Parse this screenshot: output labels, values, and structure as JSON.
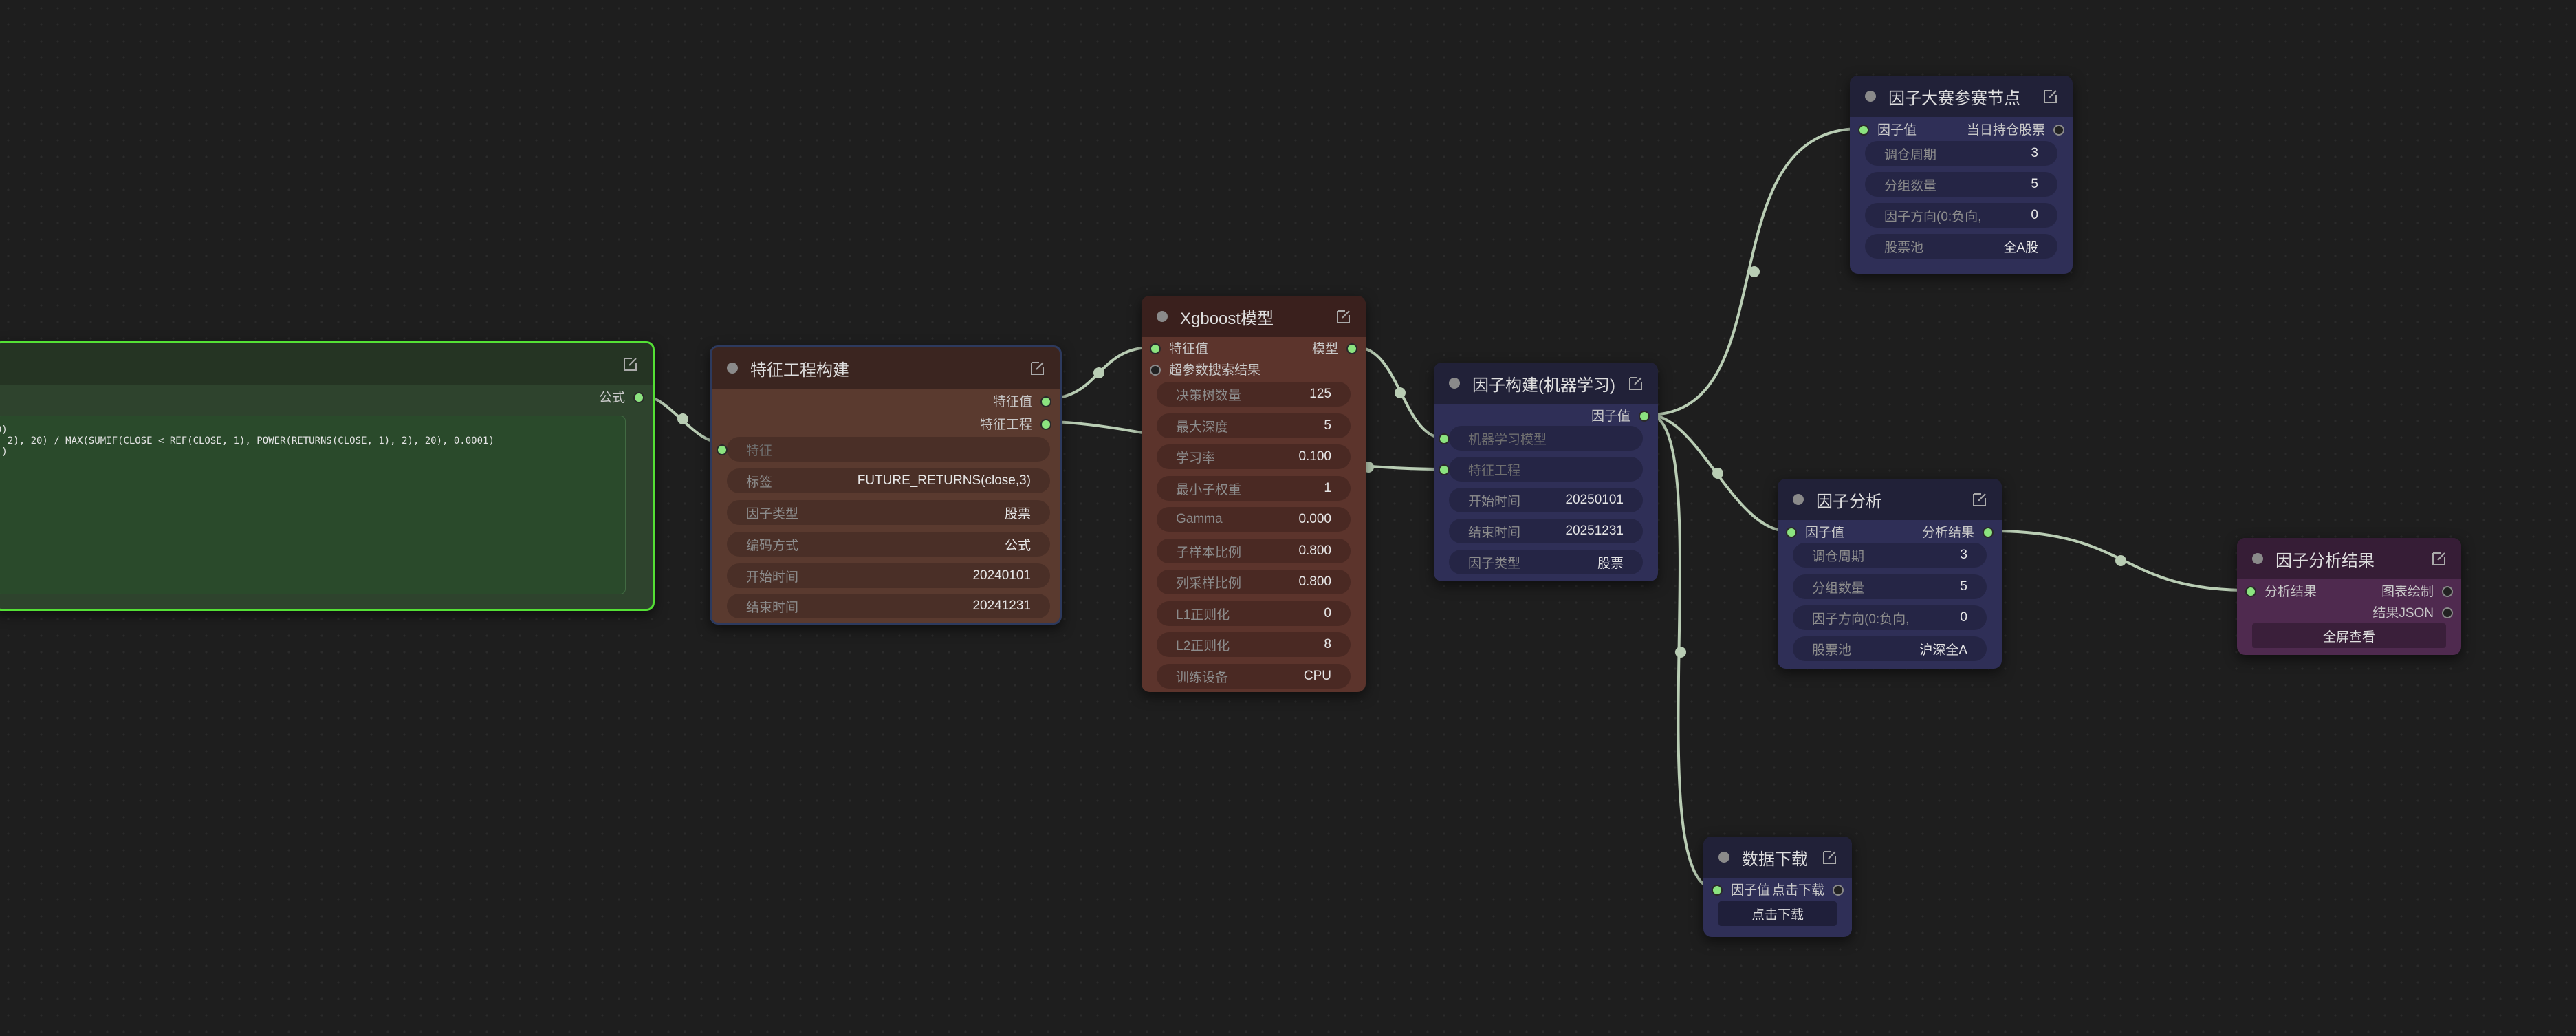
{
  "colors": {
    "background": "#1e1e1e",
    "link": "#b9cdb4",
    "port_connected": "#8be37f",
    "selected_outline": "#54e035"
  },
  "formula_node": {
    "output": "公式",
    "formula_lines": [
      "0)",
      ", 2), 20) / MAX(SUMIF(CLOSE < REF(CLOSE, 1), POWER(RETURNS(CLOSE, 1), 2), 20), 0.0001)",
      "))",
      ")"
    ]
  },
  "feature_node": {
    "title": "特征工程构建",
    "outputs": [
      "特征值",
      "特征工程"
    ],
    "input": "特征",
    "widgets": [
      {
        "label": "标签",
        "value": "FUTURE_RETURNS(close,3)"
      },
      {
        "label": "因子类型",
        "value": "股票"
      },
      {
        "label": "编码方式",
        "value": "公式"
      },
      {
        "label": "开始时间",
        "value": "20240101"
      },
      {
        "label": "结束时间",
        "value": "20241231"
      }
    ]
  },
  "xgboost_node": {
    "title": "Xgboost模型",
    "inputs": [
      "特征值",
      "超参数搜索结果"
    ],
    "output": "模型",
    "widgets": [
      {
        "label": "决策树数量",
        "value": "125"
      },
      {
        "label": "最大深度",
        "value": "5"
      },
      {
        "label": "学习率",
        "value": "0.100"
      },
      {
        "label": "最小子权重",
        "value": "1"
      },
      {
        "label": "Gamma",
        "value": "0.000"
      },
      {
        "label": "子样本比例",
        "value": "0.800"
      },
      {
        "label": "列采样比例",
        "value": "0.800"
      },
      {
        "label": "L1正则化",
        "value": "0"
      },
      {
        "label": "L2正则化",
        "value": "8"
      },
      {
        "label": "训练设备",
        "value": "CPU"
      }
    ]
  },
  "factor_build_node": {
    "title": "因子构建(机器学习)",
    "output": "因子值",
    "input_widgets": [
      {
        "label": "机器学习模型",
        "value": ""
      },
      {
        "label": "特征工程",
        "value": ""
      }
    ],
    "widgets": [
      {
        "label": "开始时间",
        "value": "20250101"
      },
      {
        "label": "结束时间",
        "value": "20251231"
      },
      {
        "label": "因子类型",
        "value": "股票"
      }
    ]
  },
  "contest_node": {
    "title": "因子大赛参赛节点",
    "input": "因子值",
    "output": "当日持仓股票",
    "widgets": [
      {
        "label": "调仓周期",
        "value": "3"
      },
      {
        "label": "分组数量",
        "value": "5"
      },
      {
        "label": "因子方向(0:负向,",
        "value": "0"
      },
      {
        "label": "股票池",
        "value": "全A股"
      }
    ]
  },
  "analysis_node": {
    "title": "因子分析",
    "input": "因子值",
    "output": "分析结果",
    "widgets": [
      {
        "label": "调仓周期",
        "value": "3"
      },
      {
        "label": "分组数量",
        "value": "5"
      },
      {
        "label": "因子方向(0:负向,",
        "value": "0"
      },
      {
        "label": "股票池",
        "value": "沪深全A"
      }
    ]
  },
  "result_node": {
    "title": "因子分析结果",
    "input": "分析结果",
    "outputs": [
      "图表绘制",
      "结果JSON"
    ],
    "button": "全屏查看"
  },
  "download_node": {
    "title": "数据下载",
    "input": "因子值",
    "output": "点击下载",
    "button": "点击下载"
  }
}
